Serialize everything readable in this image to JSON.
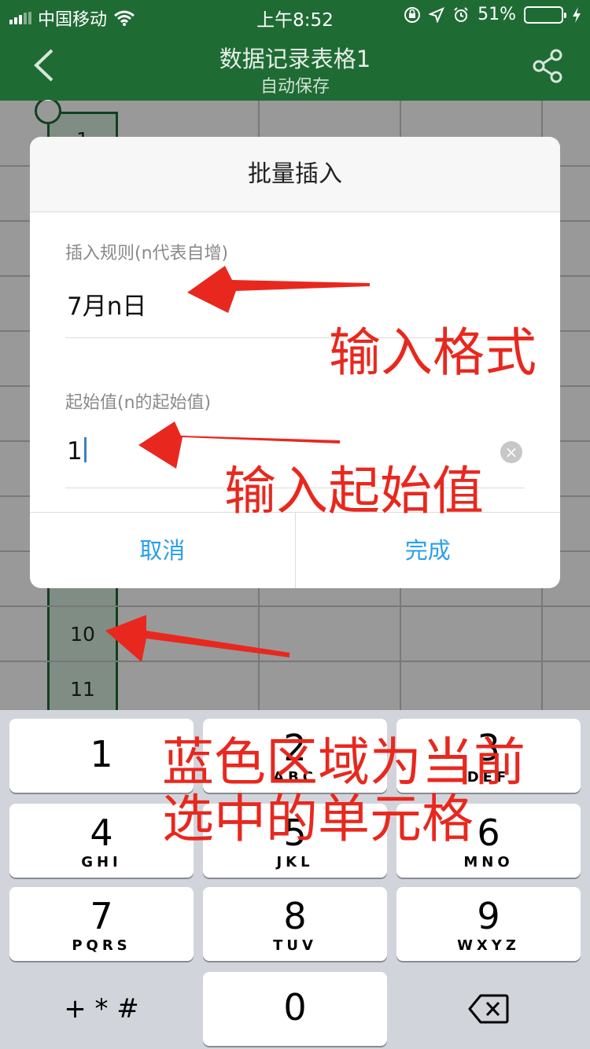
{
  "status_bar": {
    "carrier": "中国移动",
    "time": "上午8:52",
    "battery": "51%",
    "battery_level": 0.51
  },
  "nav": {
    "title": "数据记录表格1",
    "subtitle": "自动保存",
    "back_icon": "chevron-left-icon",
    "share_icon": "share-icon"
  },
  "sheet": {
    "row_labels": [
      "1",
      "10",
      "11"
    ]
  },
  "dialog": {
    "title": "批量插入",
    "rule_label": "插入规则(n代表自增)",
    "rule_value": "7月n日",
    "start_label": "起始值(n的起始值)",
    "start_value": "1",
    "cancel_label": "取消",
    "done_label": "完成"
  },
  "keypad": {
    "keys": [
      {
        "num": "1",
        "letters": ""
      },
      {
        "num": "2",
        "letters": "ABC"
      },
      {
        "num": "3",
        "letters": "DEF"
      },
      {
        "num": "4",
        "letters": "GHI"
      },
      {
        "num": "5",
        "letters": "JKL"
      },
      {
        "num": "6",
        "letters": "MNO"
      },
      {
        "num": "7",
        "letters": "PQRS"
      },
      {
        "num": "8",
        "letters": "TUV"
      },
      {
        "num": "9",
        "letters": "WXYZ"
      }
    ],
    "symbols_label": "+ * #",
    "zero": "0",
    "delete_icon": "backspace-icon"
  },
  "annotations": {
    "format_note": "输入格式",
    "start_note": "输入起始值",
    "selection_note_line1": "蓝色区域为当前",
    "selection_note_line2": "选中的单元格",
    "color": "#e8281e"
  },
  "colors": {
    "header_green": "#1f6b34",
    "selection_fill": "#d6ecdc",
    "action_blue": "#29a0e8"
  }
}
